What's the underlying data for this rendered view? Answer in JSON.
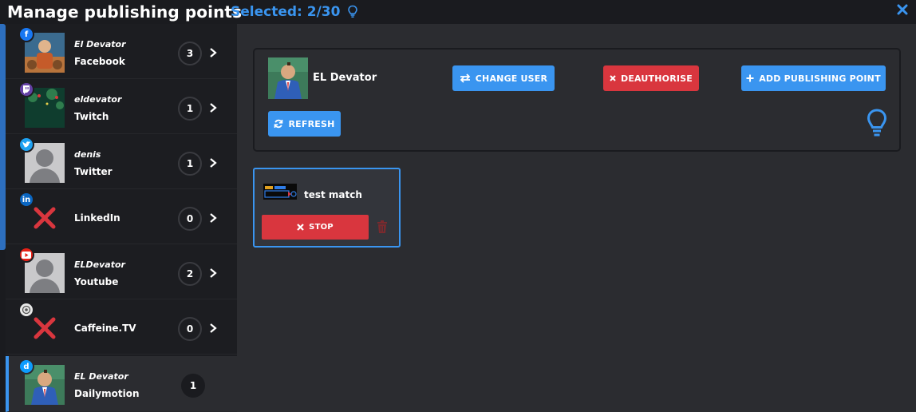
{
  "header": {
    "title": "Manage publishing points",
    "selected": "Selected: 2/30"
  },
  "sidebar": {
    "items": [
      {
        "user": "El Devator",
        "platform": "Facebook",
        "count": "3",
        "icon": "facebook-icon",
        "color": "#1877f2"
      },
      {
        "user": "eldevator",
        "platform": "Twitch",
        "count": "1",
        "icon": "twitch-icon",
        "color": "#6441a5"
      },
      {
        "user": "denis",
        "platform": "Twitter",
        "count": "1",
        "icon": "twitter-icon",
        "color": "#1da1f2"
      },
      {
        "user": "",
        "platform": "LinkedIn",
        "count": "0",
        "icon": "linkedin-icon",
        "color": "#0a66c2"
      },
      {
        "user": "ELDevator",
        "platform": "Youtube",
        "count": "2",
        "icon": "youtube-icon",
        "color": "#e62117"
      },
      {
        "user": "",
        "platform": "Caffeine.TV",
        "count": "0",
        "icon": "caffeine-icon",
        "color": "#e8e8e8"
      },
      {
        "user": "EL Devator",
        "platform": "Dailymotion",
        "count": "1",
        "icon": "dailymotion-icon",
        "color": "#0d9cff"
      }
    ]
  },
  "account": {
    "name": "EL Devator",
    "change_user": "CHANGE USER",
    "deauthorise": "DEAUTHORISE",
    "add_publishing_point": "ADD PUBLISHING POINT",
    "refresh": "REFRESH"
  },
  "publishing_point": {
    "title": "test match",
    "stop": "STOP"
  },
  "colors": {
    "accent": "#3a95f0",
    "danger": "#d9363e",
    "background": "#2b2c30",
    "sidebar": "#1c1d21"
  }
}
